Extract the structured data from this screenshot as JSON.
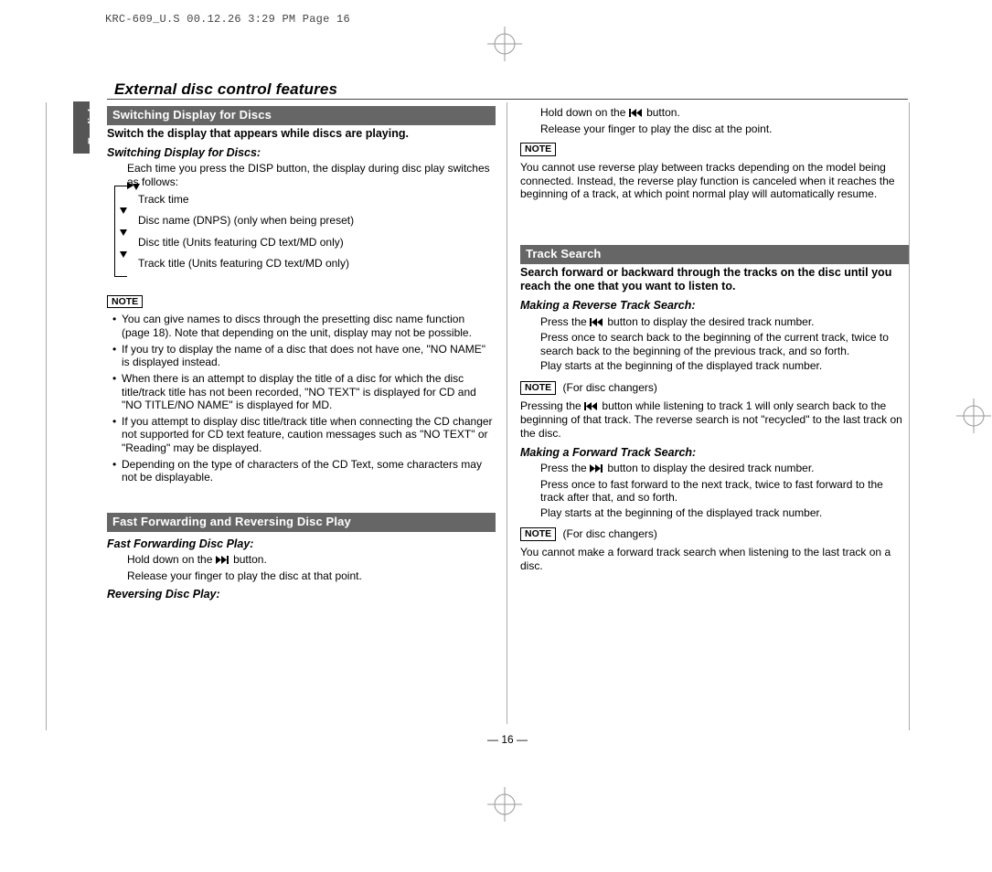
{
  "print_header": "KRC-609_U.S  00.12.26 3:29 PM  Page 16",
  "language_tab": "English",
  "page_title": "External disc control features",
  "page_number": "— 16 —",
  "left": {
    "sec1": {
      "bar": "Switching Display for Discs",
      "intro": "Switch the display that appears while discs are playing.",
      "subh": "Switching Display for Discs:",
      "body": "Each time you press the DISP button, the display during disc play switches as follows:",
      "cycle": {
        "a": "Track time",
        "b": "Disc name (DNPS) (only when being preset)",
        "c": "Disc title (Units featuring CD text/MD only)",
        "d": "Track title (Units featuring CD text/MD only)"
      },
      "note_label": "NOTE",
      "bullets": {
        "a": "You can give names to discs through the presetting disc name function (page 18). Note that depending on the unit, display may not be possible.",
        "b": "If you try to display the name of a disc that does not have one, \"NO NAME\" is displayed instead.",
        "c": "When there is an attempt to display the title of a disc for which the disc title/track title has not been recorded, \"NO TEXT\" is displayed for CD and \"NO TITLE/NO NAME\" is displayed for MD.",
        "d": "If you attempt to display disc title/track title when connecting the CD changer not supported for CD text feature, caution messages such as \"NO TEXT\" or \"Reading\" may be displayed.",
        "e": "Depending on the type of characters of the CD Text, some characters may not be displayable."
      }
    },
    "sec2": {
      "bar": "Fast Forwarding and Reversing Disc Play",
      "sub1": "Fast Forwarding Disc Play:",
      "body1a": "Hold down on the ",
      "body1b": " button.",
      "body1c": "Release your finger to play the disc at that point.",
      "sub2": "Reversing Disc Play:"
    }
  },
  "right": {
    "rev_a": "Hold down on the ",
    "rev_b": " button.",
    "rev_c": "Release your finger to play the disc at the point.",
    "note_label": "NOTE",
    "rev_note": "You cannot use reverse play between tracks depending on the model being connected. Instead, the reverse play function is canceled when it reaches the beginning of a track, at which point normal play will automatically resume.",
    "sec3": {
      "bar": "Track Search",
      "intro": "Search forward or backward through the tracks on the disc until you reach the one that you want to listen to.",
      "sub1": "Making a Reverse Track Search:",
      "b1a": "Press the ",
      "b1b": " button to display the desired track number.",
      "b1c": "Press once to search back to the beginning of the current track, twice to search back to the beginning of the previous track, and so forth.",
      "b1d": "Play starts at the beginning of the displayed track number.",
      "changer1_label": "(For disc changers)",
      "changer1_body_a": "Pressing the ",
      "changer1_body_b": " button while listening to track 1 will only search back to the beginning of that track. The reverse search is not \"recycled\" to the last track on the disc.",
      "sub2": "Making a Forward Track Search:",
      "b2a": "Press the ",
      "b2b": " button to display the desired track number.",
      "b2c": "Press once to fast forward to the next track, twice to fast forward to the track after that, and so forth.",
      "b2d": "Play starts at the beginning of the displayed track number.",
      "changer2_label": "(For disc changers)",
      "changer2_body": "You cannot make a forward track search when listening to the last track on a disc."
    }
  }
}
